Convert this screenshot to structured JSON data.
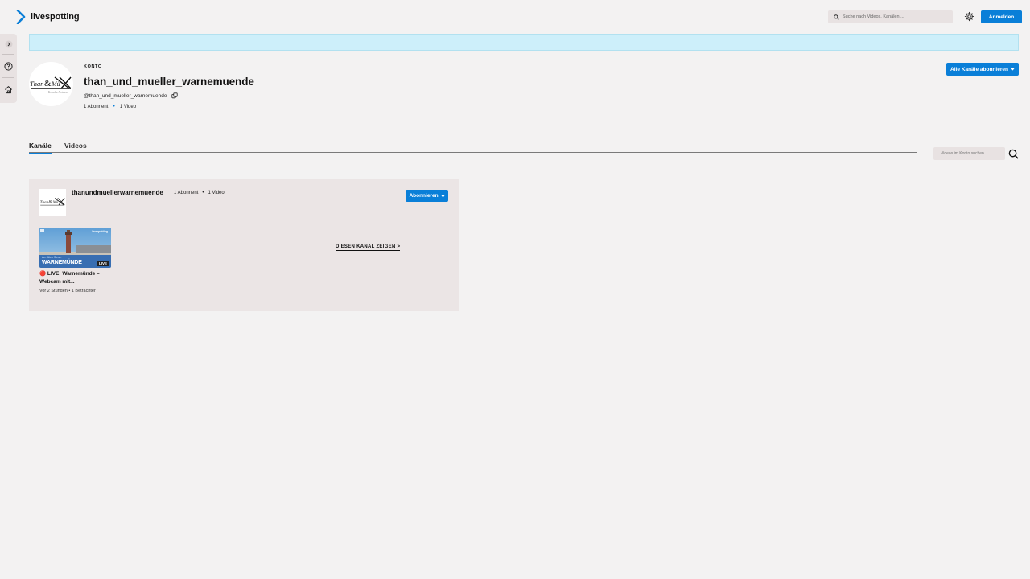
{
  "header": {
    "logo_text": "livespotting",
    "search_placeholder": "Suche nach Videos, Kanälen ...",
    "login_label": "Anmelden"
  },
  "profile": {
    "section_label": "KONTO",
    "name": "than_und_mueller_warnemuende",
    "handle": "@than_und_mueller_warnemuende",
    "subscribers": "1 Abonnent",
    "videos": "1 Video",
    "subscribe_all_label": "Alle Kanäle abonnieren"
  },
  "tabs": {
    "items": [
      {
        "label": "Kanäle"
      },
      {
        "label": "Videos"
      }
    ],
    "search_placeholder": "Videos im Konto suchen"
  },
  "channel": {
    "name": "thanundmuellerwarnemuende",
    "subscribers": "1 Abonnent",
    "videos": "1 Video",
    "subscribe_label": "Abonnieren",
    "show_channel_label": "DIESEN KANAL ZEIGEN >",
    "video": {
      "title": "🔴 LIVE: Warnemünde – Webcam mit...",
      "meta": "Vor 2 Stunden • 1 Betrachter",
      "thumb_caption": "WARNEMÜNDE",
      "thumb_subcaption": "Am Alten Strom",
      "thumb_brand": "livespotting",
      "thumb_live": "LIVE"
    }
  },
  "colors": {
    "accent": "#0a7fd8",
    "banner": "#cdeffa",
    "background": "#f3f2f2",
    "card": "#ebe5e5"
  }
}
